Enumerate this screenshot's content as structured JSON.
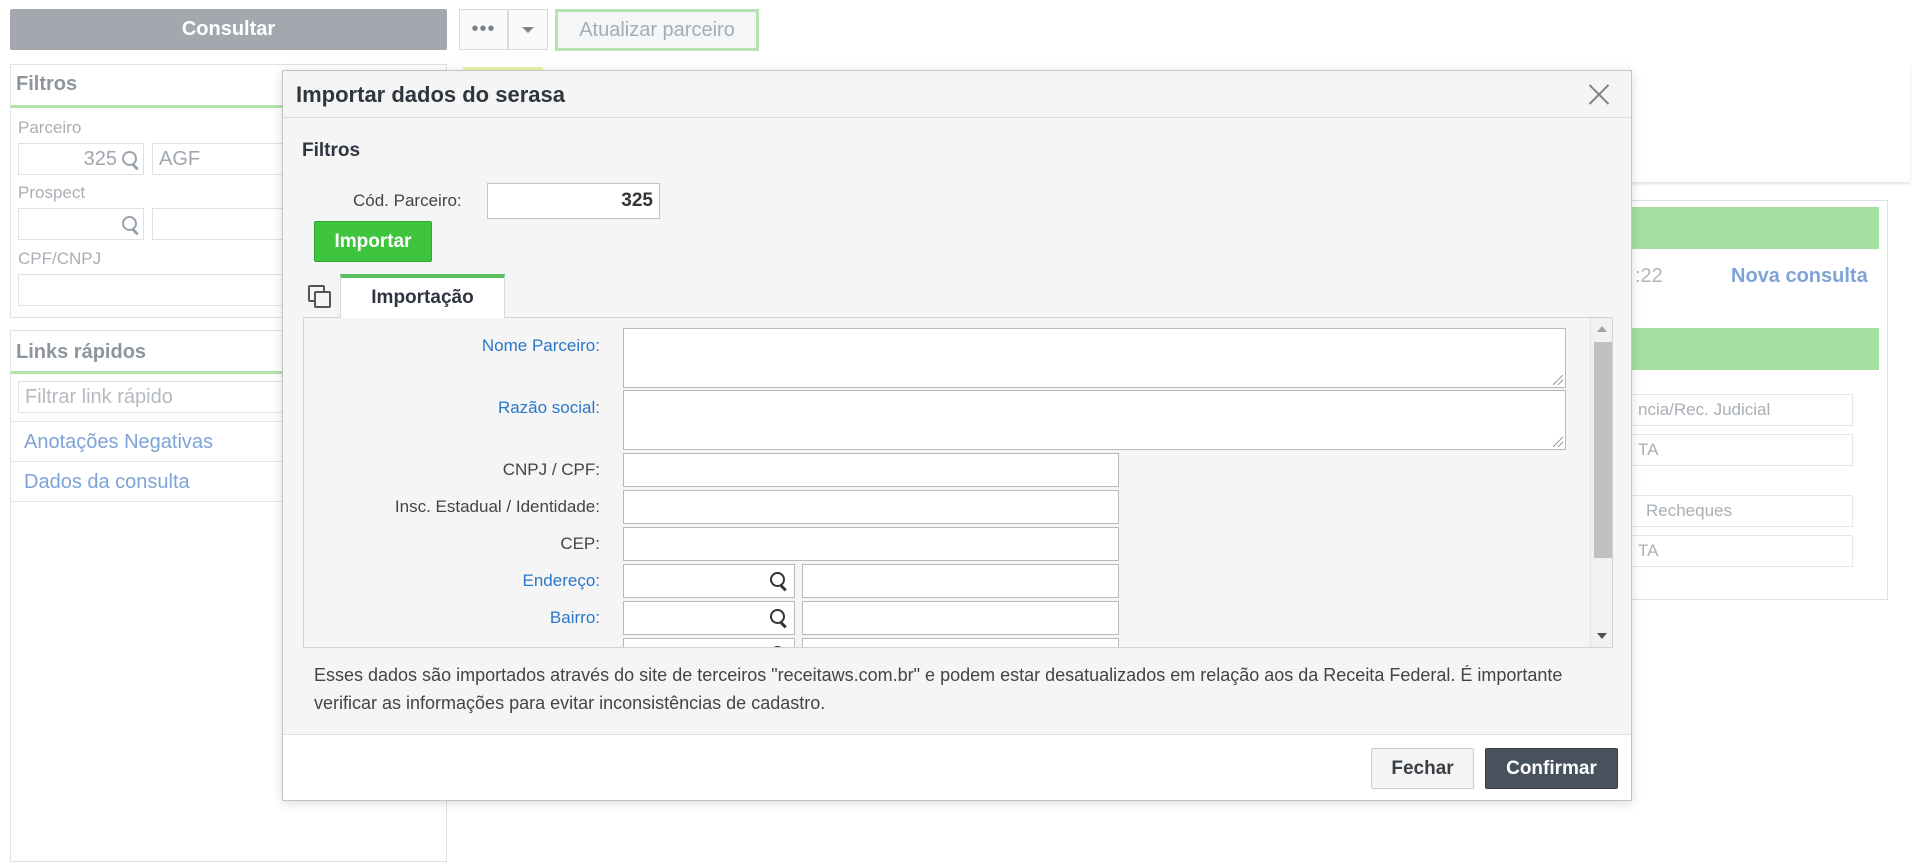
{
  "background": {
    "toolbar": {
      "consultar_label": "Consultar",
      "more_label": "•••",
      "atualizar_label": "Atualizar parceiro"
    },
    "filtros": {
      "title": "Filtros",
      "parceiro_label": "Parceiro",
      "parceiro_code": "325",
      "parceiro_name": "AGF",
      "prospect_label": "Prospect",
      "cpf_label": "CPF/CNPJ"
    },
    "links": {
      "title": "Links rápidos",
      "filter_placeholder": "Filtrar link rápido",
      "items": [
        "Anotações Negativas",
        "Dados da consulta"
      ]
    },
    "right": {
      "time_fragment": ":22",
      "nova_consulta": "Nova consulta",
      "cell1": "ncia/Rec. Judicial",
      "cell2": "TA",
      "cell3": "Recheques",
      "cell4": "TA"
    }
  },
  "modal": {
    "title": "Importar dados do serasa",
    "filters_title": "Filtros",
    "cod_label": "Cód. Parceiro:",
    "cod_value": "325",
    "importar_label": "Importar",
    "tab_label": "Importação",
    "fields": {
      "nome_parceiro": "Nome Parceiro:",
      "razao_social": "Razão social:",
      "cnpj_cpf": "CNPJ / CPF:",
      "insc_estadual": "Insc. Estadual / Identidade:",
      "cep": "CEP:",
      "endereco": "Endereço:",
      "bairro": "Bairro:"
    },
    "notice": "Esses dados são importados através do site de terceiros \"receitaws.com.br\" e podem estar desatualizados em relação aos da Receita Federal. É importante verificar as informações para evitar inconsistências de cadastro.",
    "fechar_label": "Fechar",
    "confirmar_label": "Confirmar"
  }
}
